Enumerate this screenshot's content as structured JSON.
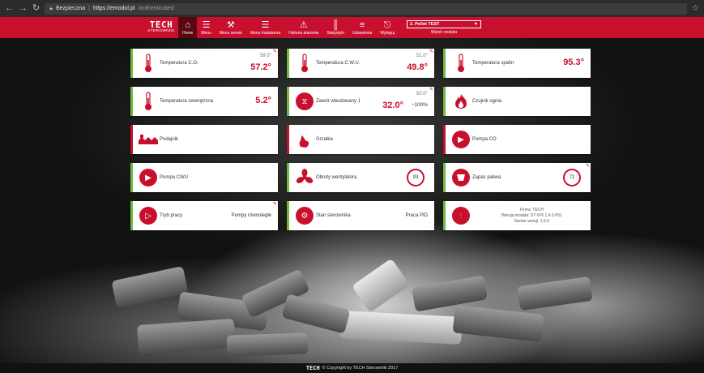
{
  "browser": {
    "secure_label": "Bezpieczna",
    "url_host": "https://emodul.pl",
    "url_path": "/authenticated"
  },
  "header": {
    "logo_brand": "TECH",
    "logo_sub": "STEROWNIKI",
    "nav": [
      {
        "label": "Home",
        "icon": "home-icon"
      },
      {
        "label": "Menu",
        "icon": "user-menu-icon"
      },
      {
        "label": "Menu serwis",
        "icon": "service-tools-icon"
      },
      {
        "label": "Menu Instalatora",
        "icon": "installer-icon"
      },
      {
        "label": "Historia alarmów",
        "icon": "warning-icon"
      },
      {
        "label": "Statystyki",
        "icon": "stats-icon"
      },
      {
        "label": "Ustawienia",
        "icon": "settings-sliders-icon"
      },
      {
        "label": "Wyloguj",
        "icon": "logout-icon"
      }
    ],
    "module_selected": "2. Pellet TEST",
    "module_label": "Wybór modułu"
  },
  "tiles": {
    "temp_co": {
      "label": "Temperatura C.O.",
      "setpoint": "58.0°",
      "value": "57.2°"
    },
    "temp_cwu": {
      "label": "Temperatura C.W.U.",
      "setpoint": "51.0°",
      "value": "49.8°"
    },
    "temp_spalin": {
      "label": "Temperatura spalin",
      "value": "95.3°"
    },
    "temp_zewn": {
      "label": "Temperatura zewnętrzna",
      "value": "5.2°"
    },
    "zawor": {
      "label": "Zawór wbudowany 1",
      "setpoint": "50.0°",
      "value": "32.0°",
      "opening": "100%"
    },
    "czujnik_ognia": {
      "label": "Czujnik ognia"
    },
    "podajnik": {
      "label": "Podajnik"
    },
    "grzalka": {
      "label": "Grzałka"
    },
    "pompa_co": {
      "label": "Pompa CO"
    },
    "pompa_cwu": {
      "label": "Pompa CWU"
    },
    "obroty": {
      "label": "Obroty wentylatora",
      "value": "93"
    },
    "zapas": {
      "label": "Zapas paliwa",
      "value": "72"
    },
    "tryb": {
      "label": "Tryb pracy",
      "value": "Pompy równoległe"
    },
    "stan": {
      "label": "Stan sterownika",
      "value": "Praca PID"
    },
    "info": {
      "line1": "Firma: TECH",
      "line2": "Wersja modułu: ST-976 1.4.0.P51",
      "line3": "Numer wersji: 1.5.0"
    }
  },
  "footer": {
    "brand": "TECH",
    "text": "© Copyright by TECH Sterowniki 2017"
  },
  "colors": {
    "brand_red": "#c8102e",
    "active_nav": "#5b0710",
    "tile_accent_green": "#6dbb3c"
  }
}
